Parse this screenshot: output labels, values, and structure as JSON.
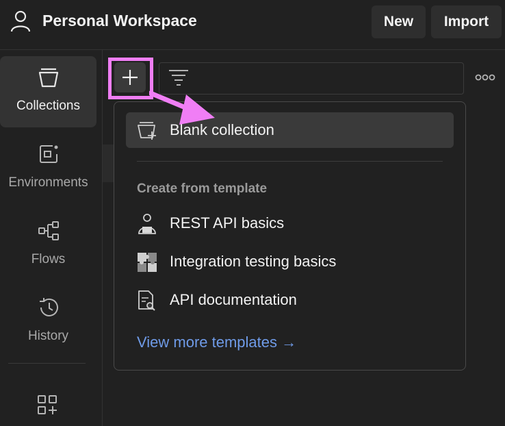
{
  "header": {
    "workspace_title": "Personal Workspace",
    "new_label": "New",
    "import_label": "Import"
  },
  "sidebar": {
    "items": [
      {
        "label": "Collections",
        "icon": "collections-icon",
        "active": true
      },
      {
        "label": "Environments",
        "icon": "environments-icon",
        "active": false
      },
      {
        "label": "Flows",
        "icon": "flows-icon",
        "active": false
      },
      {
        "label": "History",
        "icon": "history-icon",
        "active": false
      }
    ],
    "extra_icon": "add-apps-icon"
  },
  "toolbar": {
    "add_icon": "plus-icon",
    "filter_icon": "filter-icon",
    "more_icon": "more-horizontal-icon"
  },
  "dropdown": {
    "blank_label": "Blank collection",
    "section_title": "Create from template",
    "templates": [
      {
        "label": "REST API basics",
        "icon": "rest-api-icon"
      },
      {
        "label": "Integration testing basics",
        "icon": "puzzle-icon"
      },
      {
        "label": "API documentation",
        "icon": "document-search-icon"
      }
    ],
    "more_link": "View more templates →"
  },
  "colors": {
    "background": "#212121",
    "highlight": "#f07ef5",
    "link": "#6f9be8"
  }
}
